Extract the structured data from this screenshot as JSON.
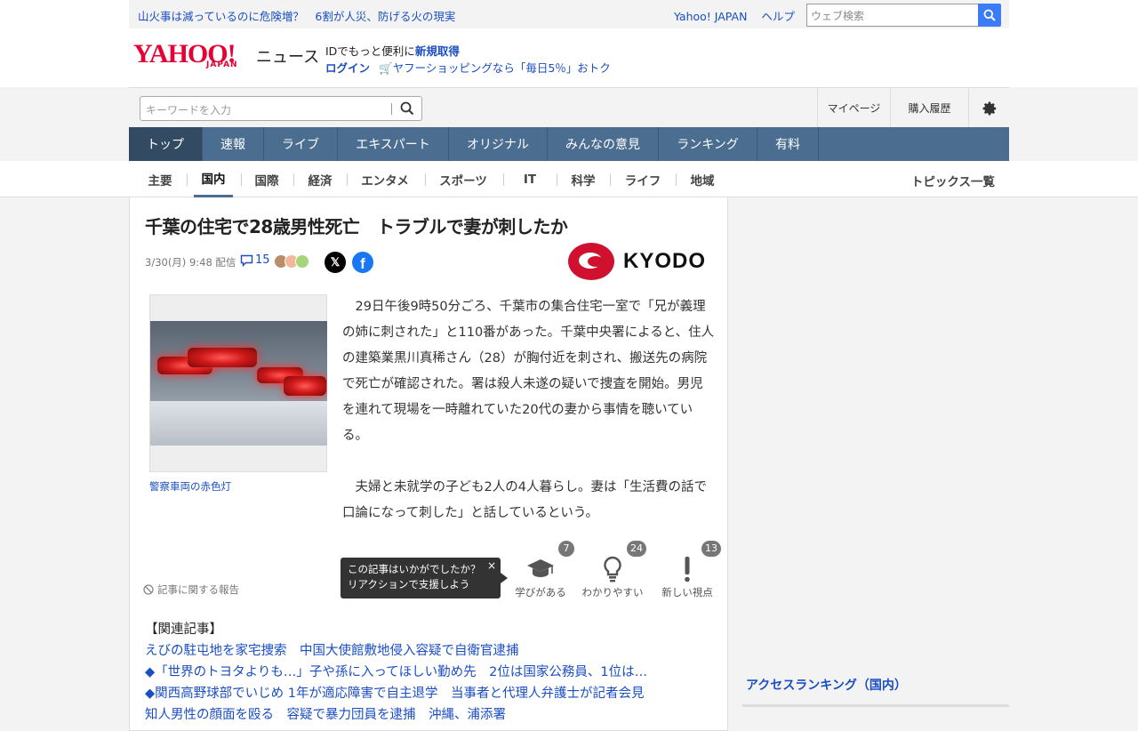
{
  "topbar": {
    "headline_link": "山火事は減っているのに危険増？　6割が人災、防げる火の現実",
    "yahoo_japan": "Yahoo! JAPAN",
    "help": "ヘルプ",
    "web_search_placeholder": "ウェブ検索"
  },
  "logo": {
    "brand": "YAHOO!",
    "sub": "JAPAN",
    "service": "ニュース"
  },
  "account": {
    "promo_prefix": "IDでもっと便利に",
    "signup": "新規取得",
    "login": "ログイン",
    "shopping_promo": "ヤフーショッピングなら「毎日5％」おトク"
  },
  "search": {
    "placeholder": "キーワードを入力",
    "mypage": "マイページ",
    "history": "購入履歴"
  },
  "main_nav": [
    "トップ",
    "速報",
    "ライブ",
    "エキスパート",
    "オリジナル",
    "みんなの意見",
    "ランキング",
    "有料"
  ],
  "sub_nav": [
    "主要",
    "国内",
    "国際",
    "経済",
    "エンタメ",
    "スポーツ",
    "IT",
    "科学",
    "ライフ",
    "地域"
  ],
  "sub_nav_active": "国内",
  "topics_all": "トピックス一覧",
  "article": {
    "title": "千葉の住宅で28歳男性死亡　トラブルで妻が刺したか",
    "date": "3/30(月) 9:48 配信",
    "comment_count": "15",
    "share_x": "𝕏",
    "share_fb": "f",
    "source_logo": "KYODO",
    "photo_caption": "警察車両の赤色灯",
    "paragraphs": [
      "29日午後9時50分ごろ、千葉市の集合住宅一室で「兄が義理の姉に刺された」と110番があった。千葉中央署によると、住人の建築業黒川真稀さん（28）が胸付近を刺され、搬送先の病院で死亡が確認された。署は殺人未遂の疑いで捜査を開始。男児を連れて現場を一時離れていた20代の妻から事情を聴いている。",
      "夫婦と未就学の子ども2人の4人暮らし。妻は「生活費の話で口論になって刺した」と話しているという。"
    ],
    "report": "記事に関する報告",
    "tooltip_line1": "この記事はいかがでしたか？",
    "tooltip_line2": "リアクションで支援しよう",
    "tooltip_close": "×",
    "reactions": [
      {
        "label": "学びがある",
        "count": "7"
      },
      {
        "label": "わかりやすい",
        "count": "24"
      },
      {
        "label": "新しい視点",
        "count": "13"
      }
    ],
    "related_header": "【関連記事】",
    "related": [
      "えびの駐屯地を家宅捜索　中国大使館敷地侵入容疑で自衛官逮捕",
      "◆「世界のトヨタよりも…」子や孫に入ってほしい勤め先　2位は国家公務員、1位は…",
      "◆関西高野球部でいじめ 1年が適応障害で自主退学　当事者と代理人弁護士が記者会見",
      "知人男性の顔面を殴る　容疑で暴力団員を逮捕　沖縄、浦添署"
    ]
  },
  "sidebar": {
    "ranking_title": "アクセスランキング（国内）"
  },
  "colors": {
    "brand_red": "#e60033",
    "nav_blue": "#4a6d90",
    "link_blue": "#1a4ec2"
  }
}
